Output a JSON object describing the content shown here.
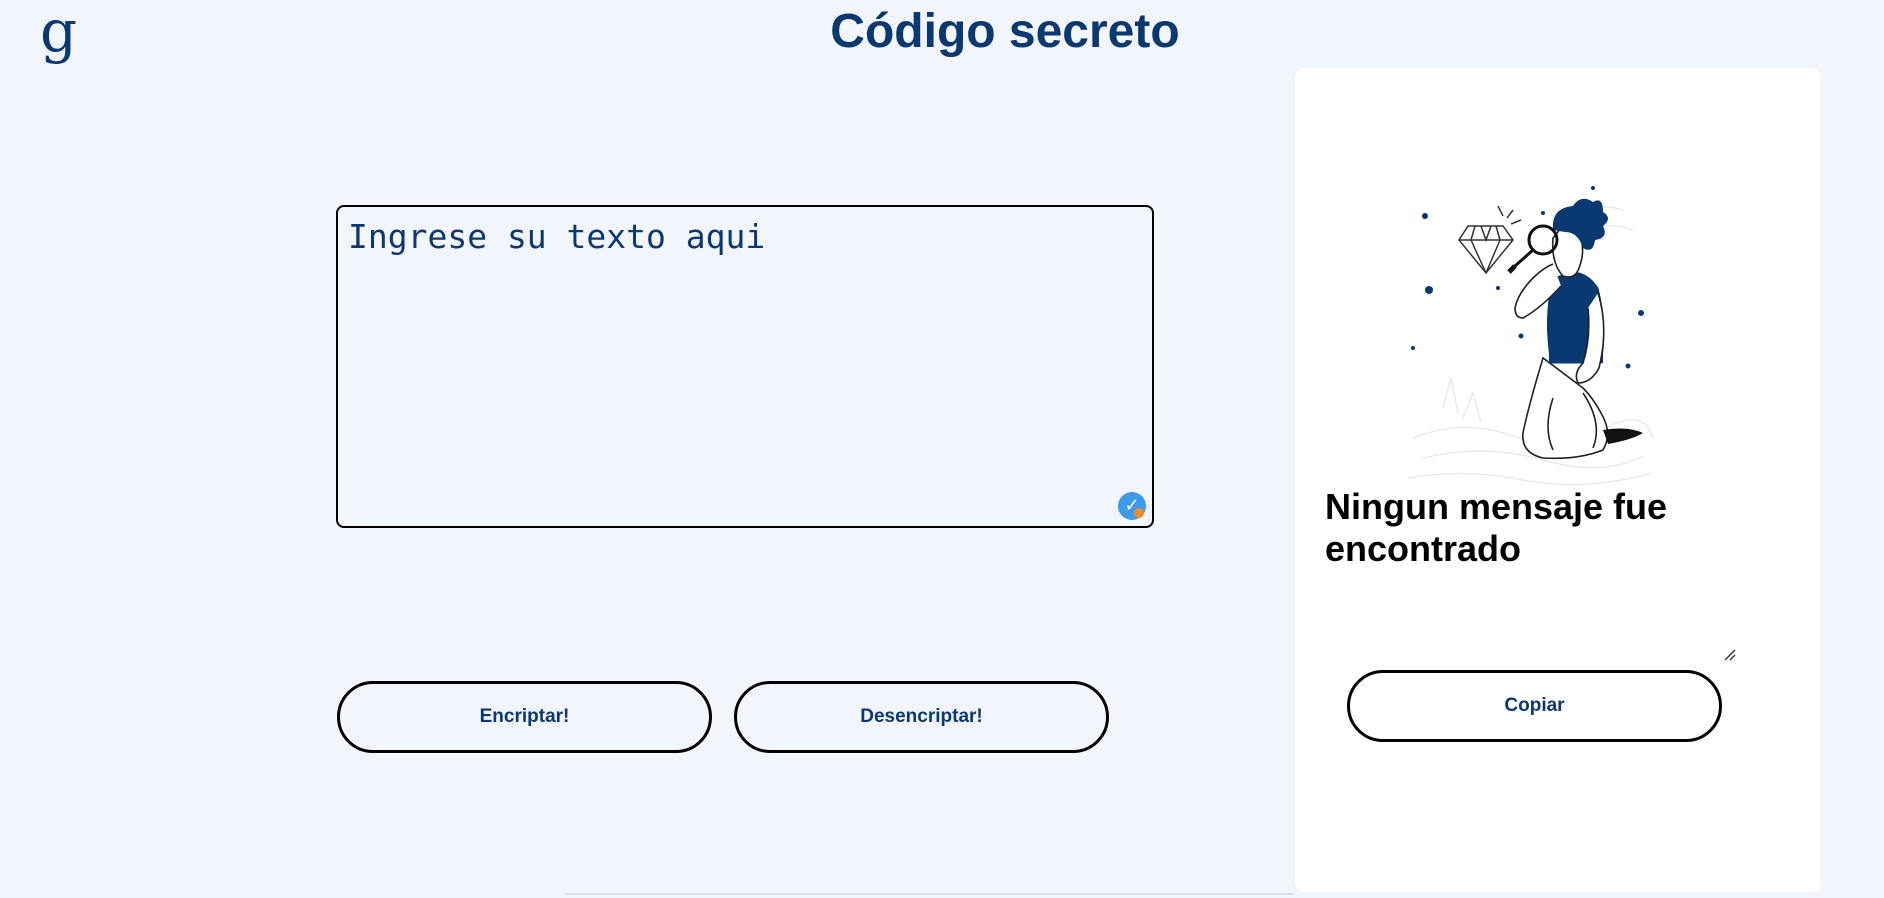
{
  "header": {
    "logo_text": "g",
    "title": "Código secreto"
  },
  "input": {
    "placeholder": "Ingrese su texto aqui",
    "value": ""
  },
  "actions": {
    "encrypt_label": "Encriptar!",
    "decrypt_label": "Desencriptar!"
  },
  "output": {
    "empty_message": "Ningun mensaje fue encontrado",
    "copy_label": "Copiar"
  },
  "colors": {
    "background": "#f3f5fc",
    "primary": "#0a3871",
    "card": "#ffffff",
    "border": "#000000"
  }
}
